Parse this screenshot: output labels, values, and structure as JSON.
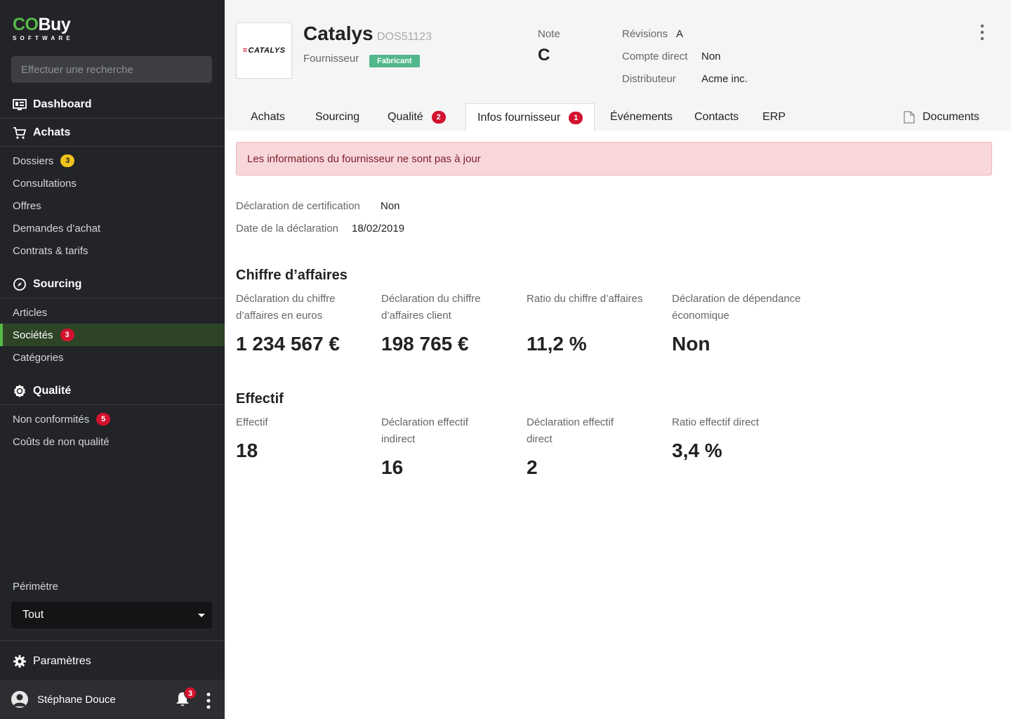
{
  "sidebar": {
    "logo": {
      "co": "CO",
      "buy": "Buy",
      "sub": "SOFTWARE"
    },
    "search_placeholder": "Effectuer une recherche",
    "dashboard": "Dashboard",
    "achats": {
      "title": "Achats",
      "items": [
        {
          "label": "Dossiers",
          "badge": "3"
        },
        {
          "label": "Consultations"
        },
        {
          "label": "Offres"
        },
        {
          "label": "Demandes d’achat"
        },
        {
          "label": "Contrats & tarifs"
        }
      ]
    },
    "sourcing": {
      "title": "Sourcing",
      "items": [
        {
          "label": "Articles"
        },
        {
          "label": "Sociétés",
          "badge": "3",
          "active": true
        },
        {
          "label": "Catégories"
        }
      ]
    },
    "qualite": {
      "title": "Qualité",
      "items": [
        {
          "label": "Non conformités",
          "badge": "5"
        },
        {
          "label": "Coûts de non qualité"
        }
      ]
    },
    "perimetre_label": "Périmètre",
    "perimetre_value": "Tout",
    "parametres": "Paramètres",
    "user_name": "Stéphane Douce",
    "notifications_count": "3"
  },
  "header": {
    "company_logo": {
      "mark": "=",
      "text": "CATALYS"
    },
    "name": "Catalys",
    "code": "DOS51123",
    "role": "Fournisseur",
    "tag": "Fabricant",
    "note_label": "Note",
    "note_value": "C",
    "revisions_label": "Révisions",
    "revisions_value": "A",
    "compte_direct_label": "Compte direct",
    "compte_direct_value": "Non",
    "distributeur_label": "Distributeur",
    "distributeur_value": "Acme inc."
  },
  "tabs": {
    "achats": "Achats",
    "sourcing": "Sourcing",
    "qualite": "Qualité",
    "qualite_badge": "2",
    "infos": "Infos fournisseur",
    "infos_badge": "1",
    "evenements": "Événements",
    "contacts": "Contacts",
    "erp": "ERP",
    "documents": "Documents"
  },
  "content": {
    "alert": "Les informations du fournisseur ne sont pas à jour",
    "certif_label": "Déclaration de certification",
    "certif_value": "Non",
    "date_label": "Date de la déclaration",
    "date_value": "18/02/2019",
    "ca_title": "Chiffre d’affaires",
    "ca_stats": [
      {
        "label": "Déclaration du chiffre d’affaires en euros",
        "value": "1 234 567 €"
      },
      {
        "label": "Déclaration du chiffre d’affaires client",
        "value": "198 765 €"
      },
      {
        "label": "Ratio du chiffre d’affaires",
        "value": "11,2 %"
      },
      {
        "label": "Déclaration de dépendance économique",
        "value": "Non"
      }
    ],
    "effectif_title": "Effectif",
    "effectif_stats": [
      {
        "label": "Effectif",
        "value": "18"
      },
      {
        "label": "Déclaration effectif indirect",
        "value": "16"
      },
      {
        "label": "Déclaration effectif direct",
        "value": "2"
      },
      {
        "label": "Ratio effectif direct",
        "value": "3,4 %"
      }
    ]
  },
  "colors": {
    "brand_green": "#57b947",
    "sidebar_bg": "#222428",
    "badge_red": "#d2122e",
    "badge_yellow": "#f0c419",
    "tag_green": "#52b78b",
    "alert_bg": "#f8d7da"
  }
}
